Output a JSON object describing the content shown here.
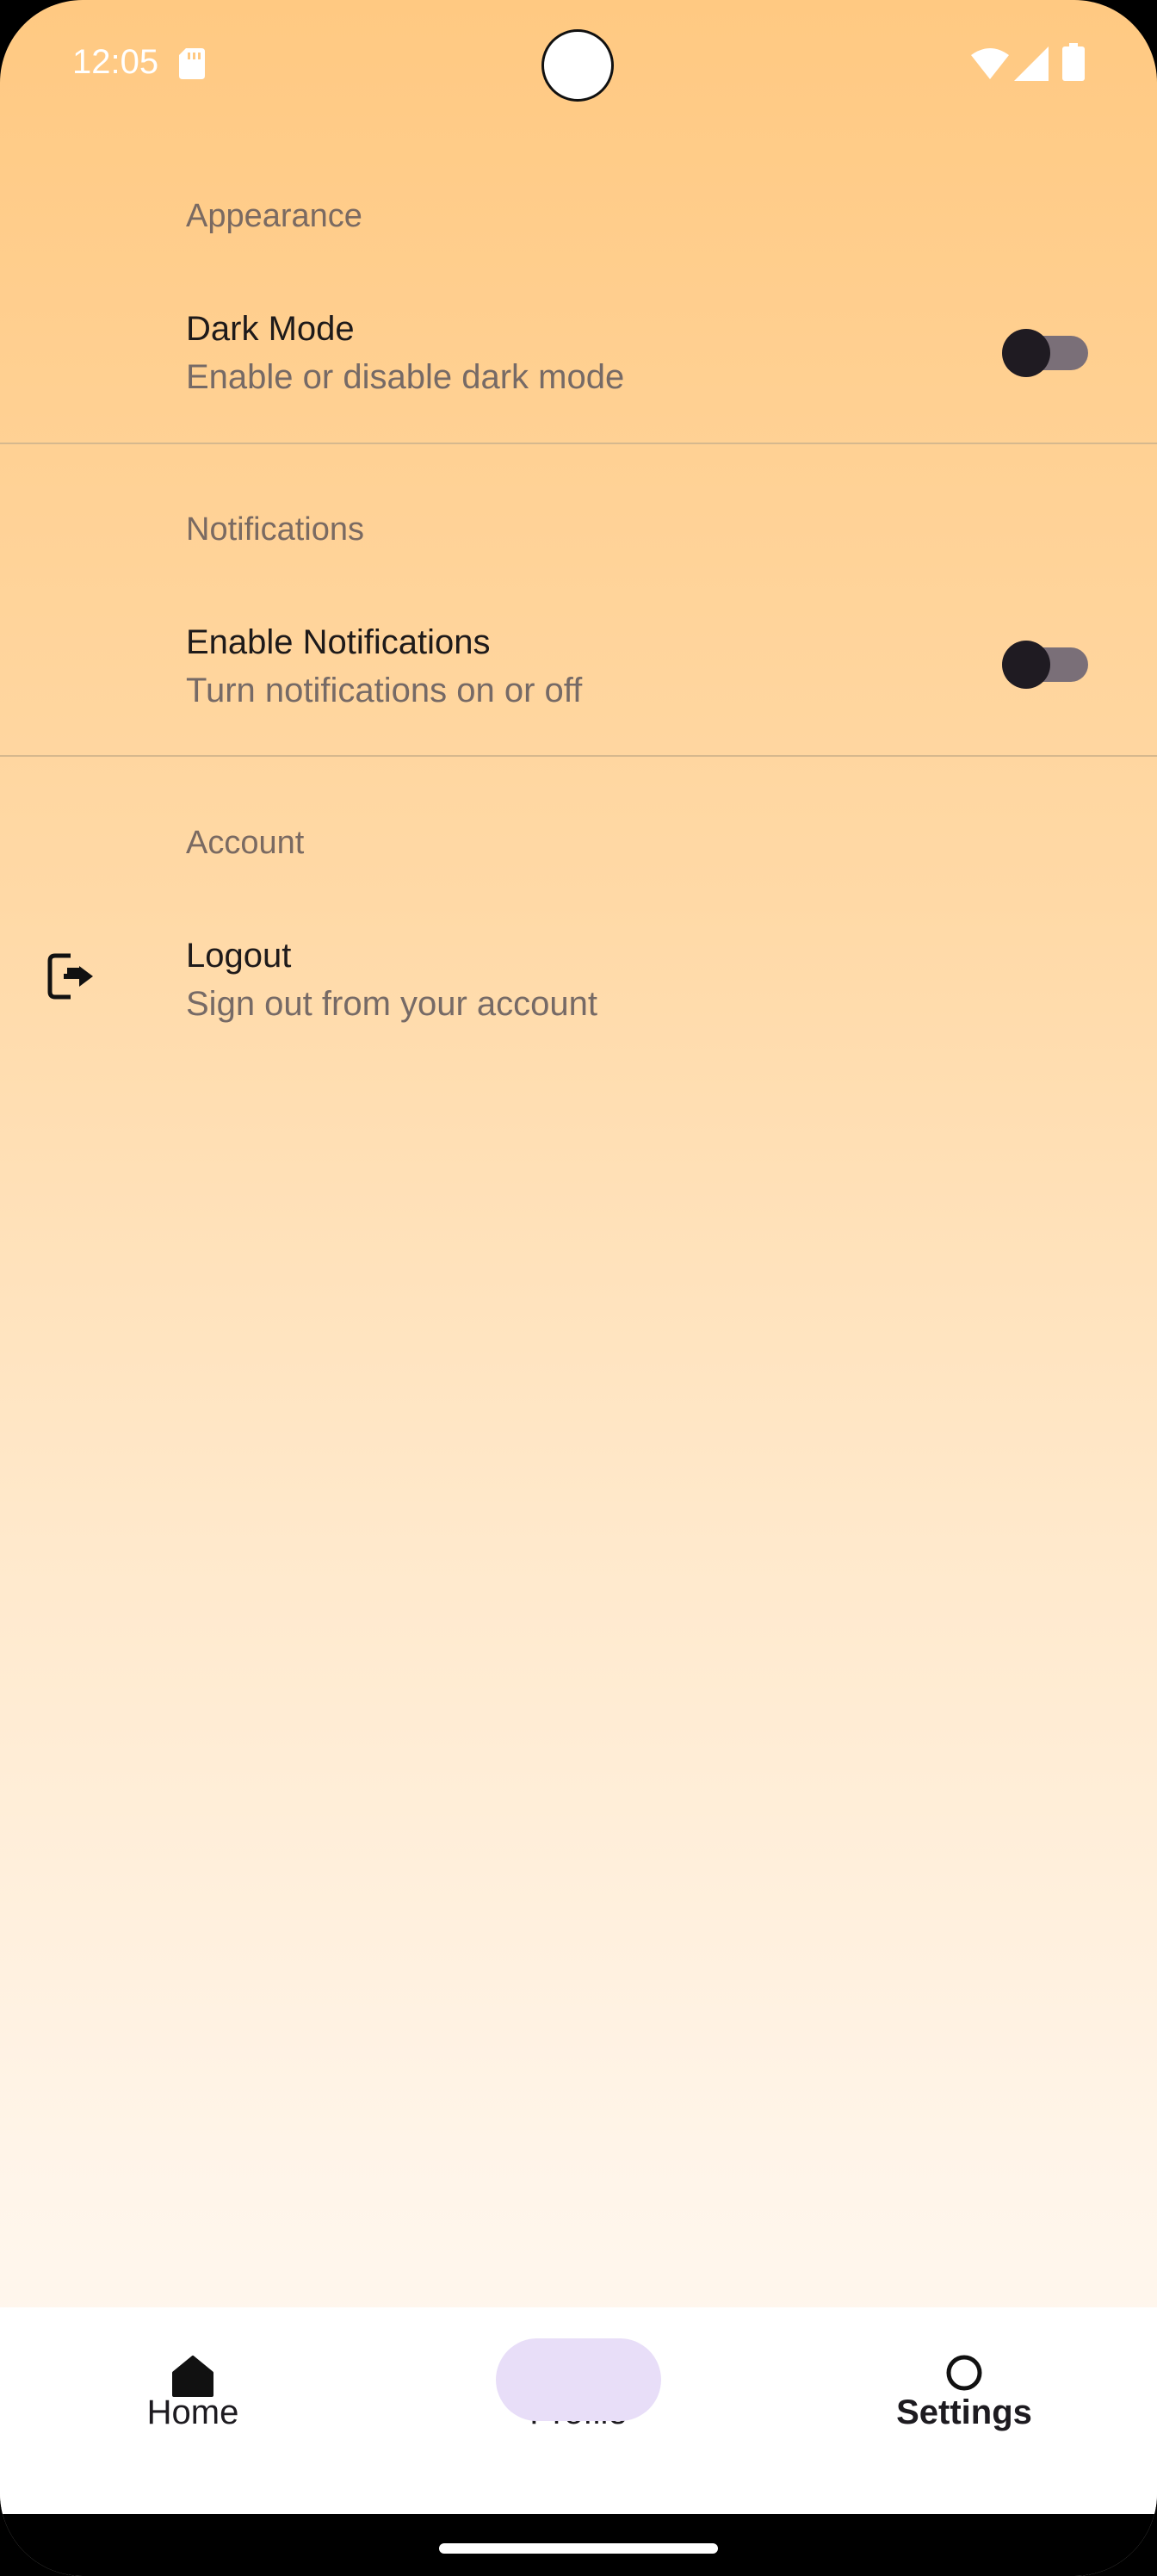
{
  "status_bar": {
    "time": "12:05",
    "icons": [
      "sd-card-icon",
      "wifi-icon",
      "signal-icon",
      "battery-icon"
    ]
  },
  "sections": {
    "appearance": {
      "title": "Appearance",
      "dark_mode": {
        "label": "Dark Mode",
        "description": "Enable or disable dark mode",
        "enabled": false
      }
    },
    "notifications": {
      "title": "Notifications",
      "enable_notifications": {
        "label": "Enable Notifications",
        "description": "Turn notifications on or off",
        "enabled": false
      }
    },
    "account": {
      "title": "Account",
      "logout": {
        "label": "Logout",
        "description": "Sign out from your account",
        "icon": "logout-icon"
      }
    }
  },
  "bottom_nav": {
    "items": [
      {
        "label": "Home",
        "icon": "home-icon",
        "selected": false
      },
      {
        "label": "Profile",
        "icon": "person-icon",
        "selected": false
      },
      {
        "label": "Settings",
        "icon": "circle-icon",
        "selected": true
      }
    ]
  },
  "colors": {
    "background_top": "#ffc982",
    "background_bottom": "#fffaf3",
    "switch_thumb": "#1f1b22",
    "switch_track": "#7a6f78",
    "nav_selected_pill": "#e8def8",
    "divider": "#d6b88e"
  }
}
